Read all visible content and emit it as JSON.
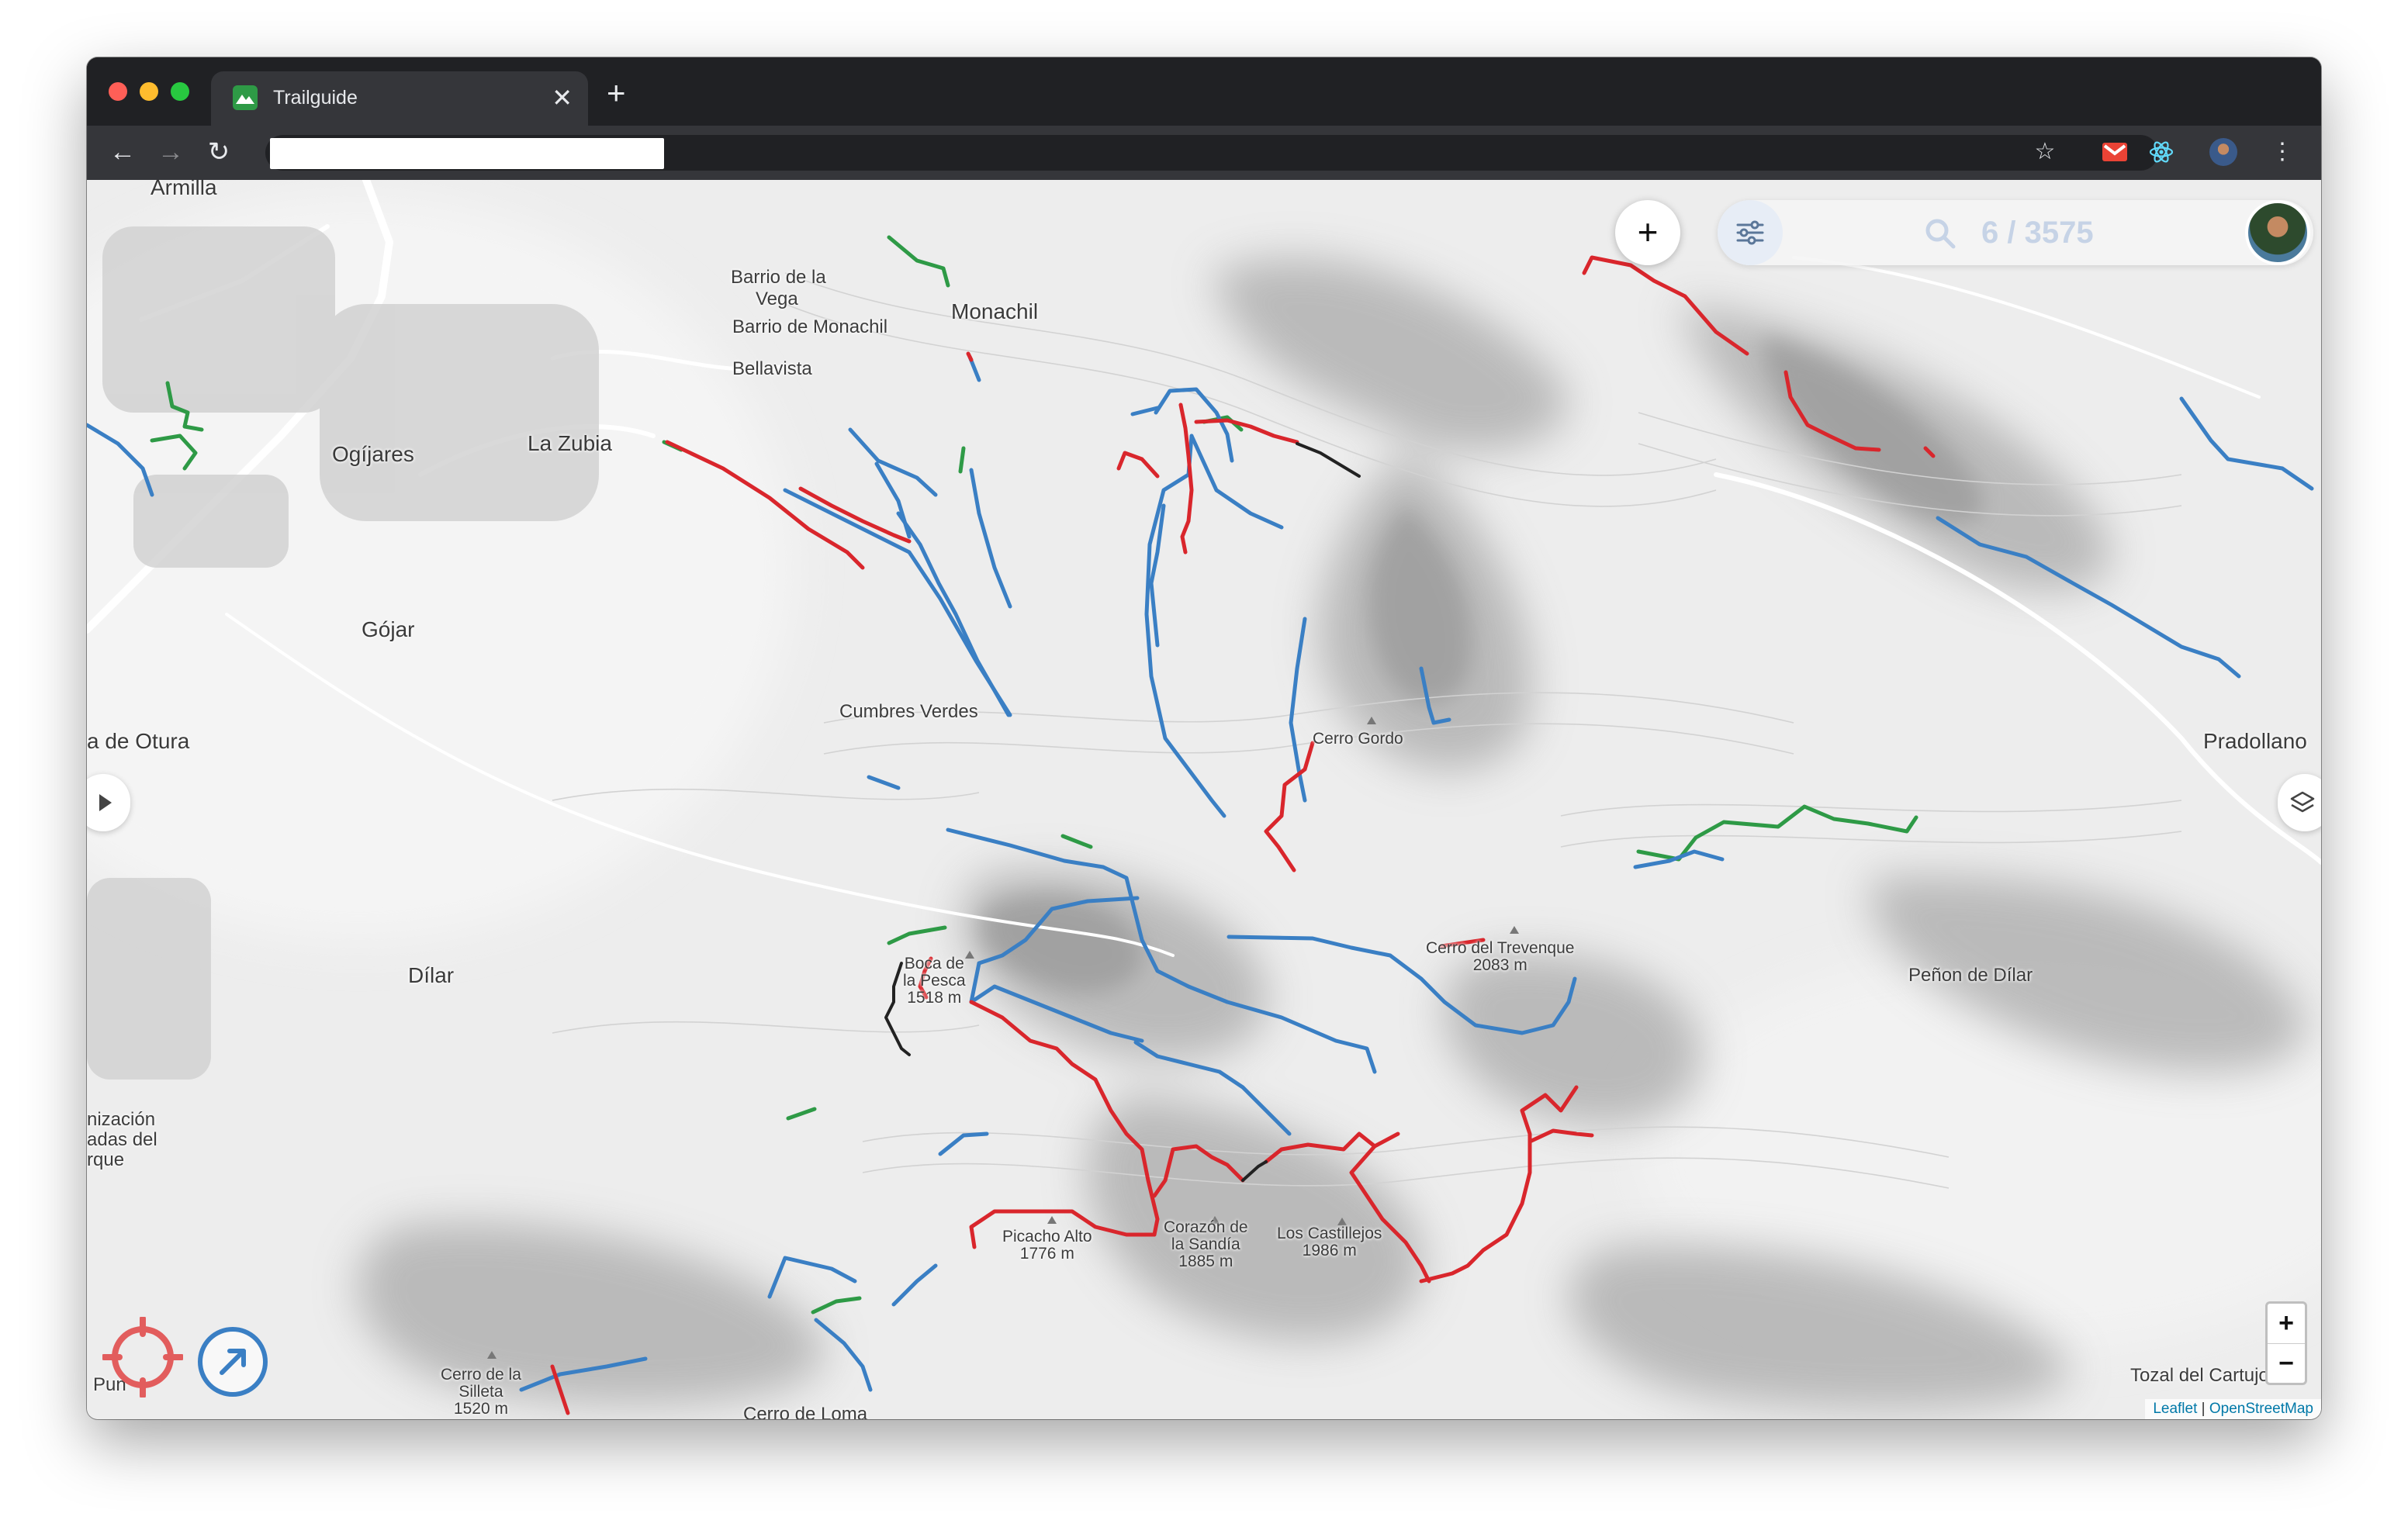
{
  "browser": {
    "tab_title": "Trailguide",
    "tab_close": "✕",
    "new_tab": "+",
    "url": "",
    "nav": {
      "back": "←",
      "forward": "→",
      "reload": "↻"
    }
  },
  "toolbar_icons": {
    "star": "☆",
    "menu": "⋮"
  },
  "map": {
    "search_count": "6 / 3575",
    "add_button": "+",
    "zoom_in": "+",
    "zoom_out": "−",
    "attribution_leaflet": "Leaflet",
    "attribution_separator": " | ",
    "attribution_osm": "OpenStreetMap",
    "places": {
      "armilla": "Armilla",
      "barrio_vega_1": "Barrio de la",
      "barrio_vega_2": "Vega",
      "barrio_monachil": "Barrio de Monachil",
      "monachil": "Monachil",
      "bellavista": "Bellavista",
      "ogijares": "Ogíjares",
      "la_zubia": "La Zubia",
      "gojar": "Gójar",
      "cumbres_verdes": "Cumbres Verdes",
      "otura": "a de Otura",
      "dilar": "Dílar",
      "pradollano": "Pradollano",
      "penon_dilar": "Peñon de Dílar",
      "urb_1": "nización",
      "urb_2": "adas del",
      "urb_3": "rque",
      "puntal": "Pun",
      "tozal": "Tozal del Cartujo",
      "cerro_loma": "Cerro de Loma"
    },
    "peaks": {
      "cerro_gordo": "Cerro Gordo",
      "trevenque_name": "Cerro del Trevenque",
      "trevenque_elev": "2083 m",
      "boca_1": "Boca de",
      "boca_2": "la Pesca",
      "boca_elev": "1518 m",
      "picacho_name": "Picacho Alto",
      "picacho_elev": "1776 m",
      "corazon_1": "Corazón de",
      "corazon_2": "la Sandía",
      "corazon_elev": "1885 m",
      "castillejos_name": "Los Castillejos",
      "castillejos_elev": "1986 m",
      "silleta_1": "Cerro de la",
      "silleta_2": "Silleta",
      "silleta_elev": "1520 m"
    },
    "trail_colors": {
      "easy": "#2e9a46",
      "moderate": "#3a7fc4",
      "difficult": "#d9262c",
      "extreme": "#222222"
    }
  }
}
